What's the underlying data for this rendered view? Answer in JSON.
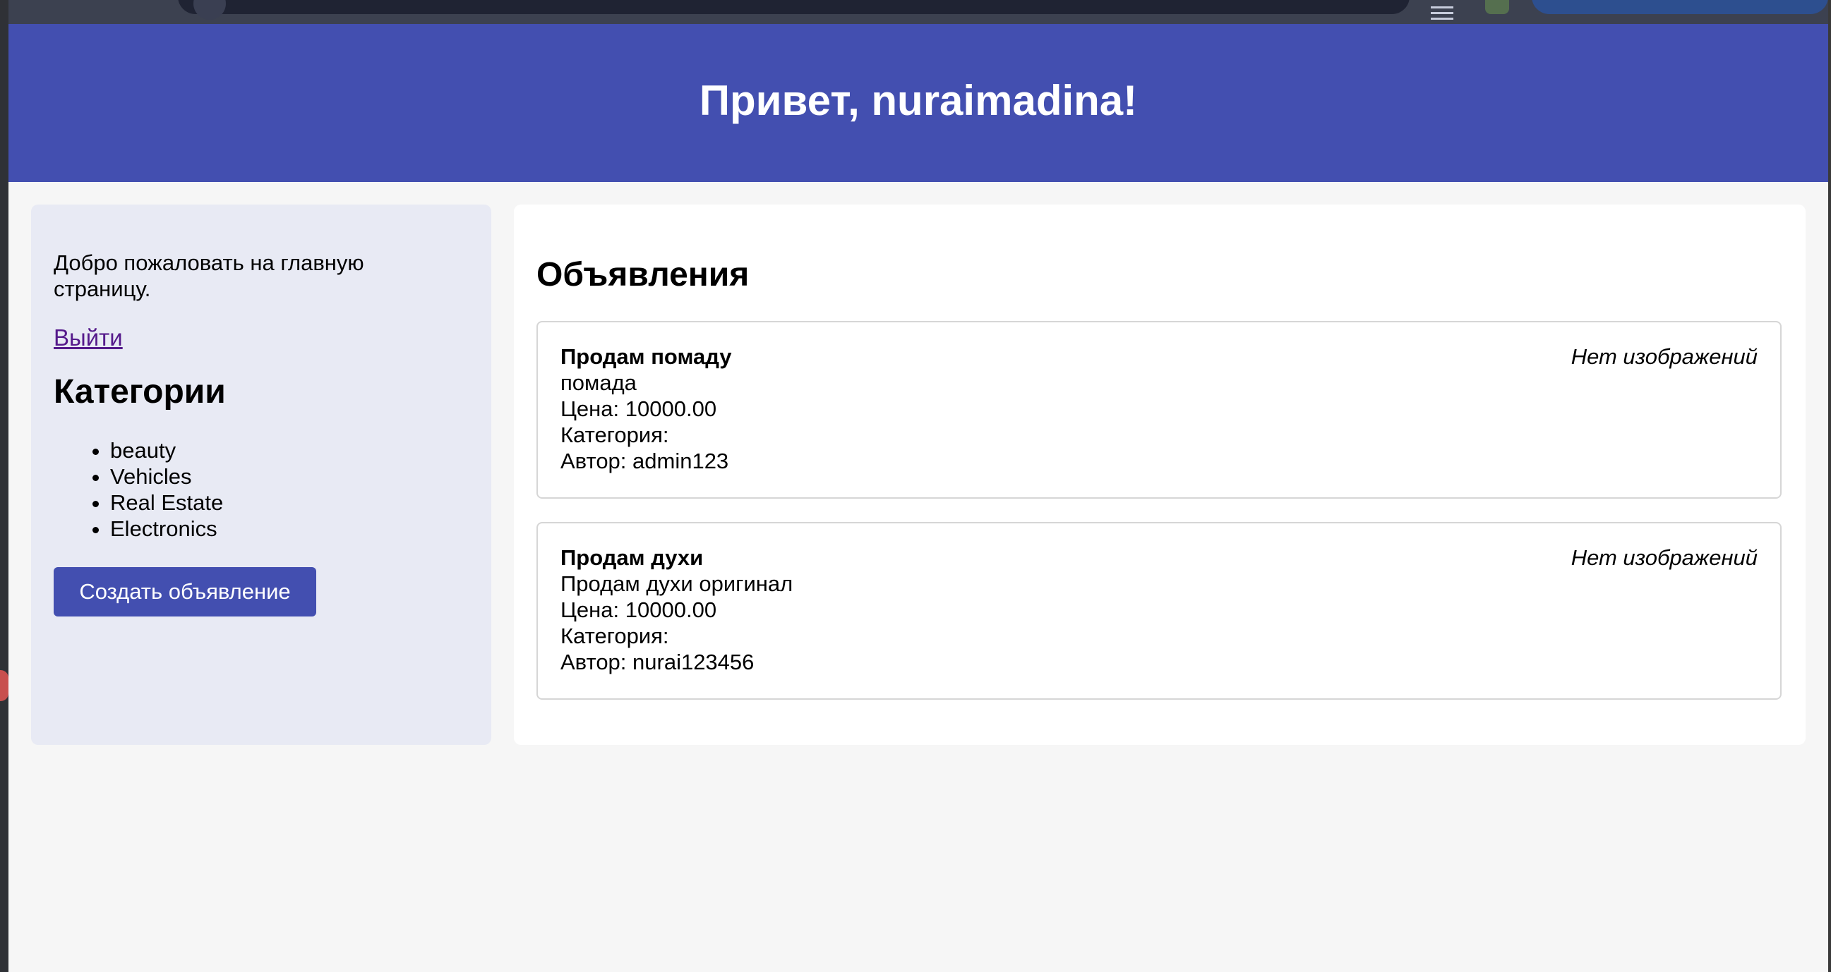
{
  "header": {
    "greeting": "Привет, nuraimadina!"
  },
  "sidebar": {
    "welcome_text": "Добро пожаловать на главную страницу.",
    "logout_label": "Выйти",
    "categories_title": "Категории",
    "categories": [
      "beauty",
      "Vehicles",
      "Real Estate",
      "Electronics"
    ],
    "create_button_label": "Создать объявление"
  },
  "main": {
    "title": "Объявления",
    "listings": [
      {
        "title": "Продам помаду",
        "description": "помада",
        "price_line": "Цена: 10000.00",
        "category_line": "Категория:",
        "author_line": "Автор: admin123",
        "image_note": "Нет изображений"
      },
      {
        "title": "Продам духи",
        "description": "Продам духи оригинал",
        "price_line": "Цена: 10000.00",
        "category_line": "Категория:",
        "author_line": "Автор: nurai123456",
        "image_note": "Нет изображений"
      }
    ]
  },
  "colors": {
    "header_bg": "#434fb0",
    "sidebar_bg": "#e8eaf4",
    "page_bg": "#f6f6f6",
    "link": "#551a8b"
  },
  "icons": {
    "browser_menu": "menu-icon",
    "browser_extension": "extension-icon"
  }
}
